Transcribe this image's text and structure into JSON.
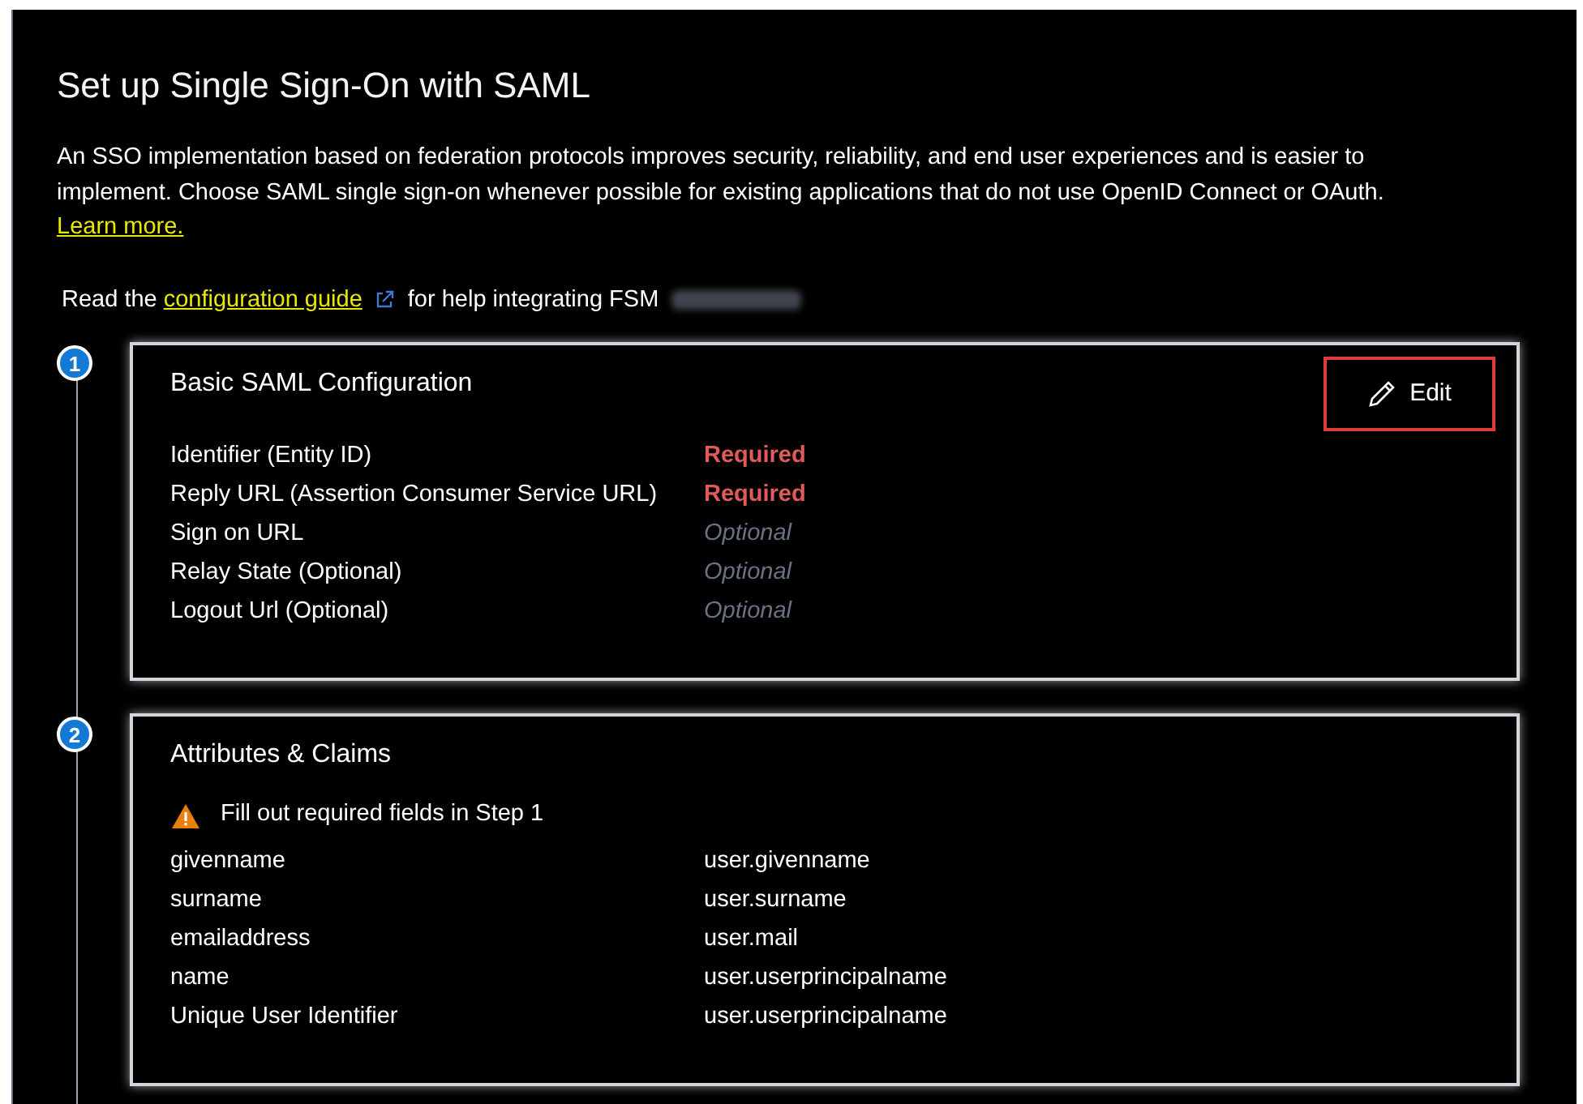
{
  "title": "Set up Single Sign-On with SAML",
  "intro": {
    "text": "An SSO implementation based on federation protocols improves security, reliability, and end user experiences and is easier to implement. Choose SAML single sign-on whenever possible for existing applications that do not use OpenID Connect or OAuth.",
    "link": "Learn more."
  },
  "guide": {
    "before": "Read the",
    "link": "configuration guide",
    "after": "for help integrating FSM"
  },
  "steps": [
    {
      "number": "1",
      "title": "Basic SAML Configuration",
      "edit_button": "Edit",
      "rows": [
        {
          "label": "Identifier (Entity ID)",
          "value": "Required",
          "kind": "required"
        },
        {
          "label": "Reply URL (Assertion Consumer Service URL)",
          "value": "Required",
          "kind": "required"
        },
        {
          "label": "Sign on URL",
          "value": "Optional",
          "kind": "optional"
        },
        {
          "label": "Relay State (Optional)",
          "value": "Optional",
          "kind": "optional"
        },
        {
          "label": "Logout Url (Optional)",
          "value": "Optional",
          "kind": "optional"
        }
      ]
    },
    {
      "number": "2",
      "title": "Attributes & Claims",
      "warning": "Fill out required fields in Step 1",
      "rows": [
        {
          "label": "givenname",
          "value": "user.givenname",
          "kind": "plain"
        },
        {
          "label": "surname",
          "value": "user.surname",
          "kind": "plain"
        },
        {
          "label": "emailaddress",
          "value": "user.mail",
          "kind": "plain"
        },
        {
          "label": "name",
          "value": "user.userprincipalname",
          "kind": "plain"
        },
        {
          "label": "Unique User Identifier",
          "value": "user.userprincipalname",
          "kind": "plain"
        }
      ]
    }
  ]
}
